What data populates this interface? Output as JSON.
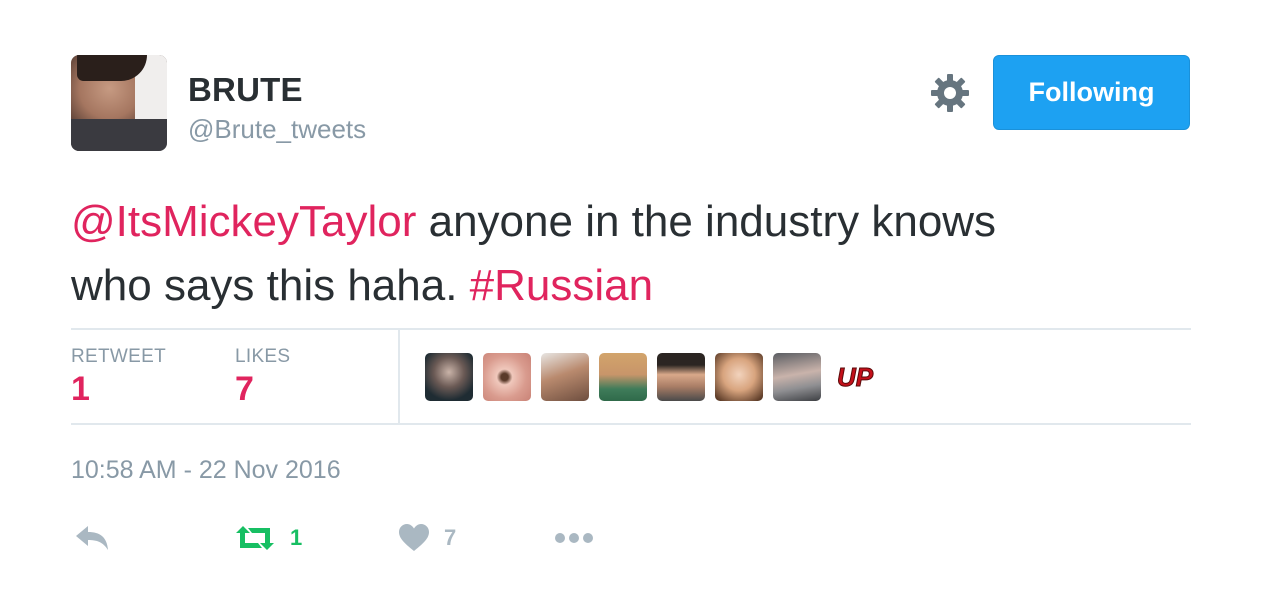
{
  "user": {
    "display_name": "BRUTE",
    "handle": "@Brute_tweets"
  },
  "header": {
    "follow_label": "Following",
    "settings_icon": "gear-icon"
  },
  "tweet": {
    "mention": "@ItsMickeyTaylor",
    "text_line1_rest": " anyone in the industry knows",
    "text_line2": "who says this haha. ",
    "hashtag": "#Russian"
  },
  "stats": {
    "retweet_label": "RETWEET",
    "retweet_count": "1",
    "likes_label": "LIKES",
    "likes_count": "7"
  },
  "likers_count": 8,
  "timestamp": "10:58 AM - 22 Nov 2016",
  "actions": {
    "reply_icon": "reply-icon",
    "retweet_icon": "retweet-icon",
    "retweet_count": "1",
    "like_icon": "heart-icon",
    "like_count": "7",
    "more_icon": "more-dots-icon"
  },
  "colors": {
    "accent": "#1da1f2",
    "link": "#e0245e",
    "muted": "#8899a6",
    "retweet_green": "#17bf63",
    "icon_gray": "#aab8c2"
  }
}
